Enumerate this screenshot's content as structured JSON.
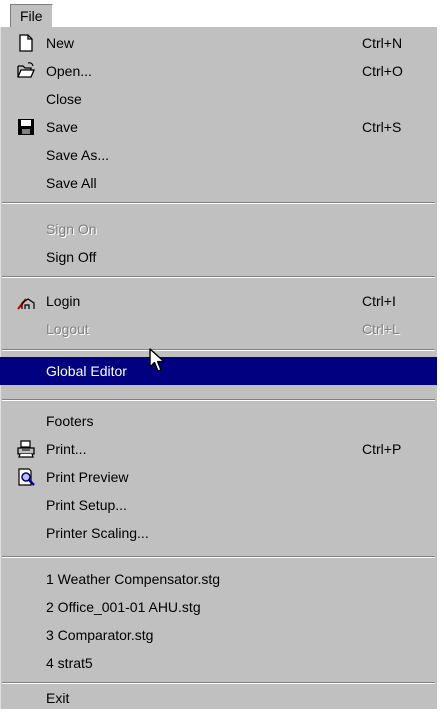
{
  "menubar": {
    "file_label": "File"
  },
  "items": {
    "new": {
      "label": "New",
      "shortcut": "Ctrl+N",
      "icon": "new-document-icon"
    },
    "open": {
      "label": "Open...",
      "shortcut": "Ctrl+O",
      "icon": "open-folder-icon"
    },
    "close": {
      "label": "Close"
    },
    "save": {
      "label": "Save",
      "shortcut": "Ctrl+S",
      "icon": "floppy-disk-icon"
    },
    "save_as": {
      "label": "Save As..."
    },
    "save_all": {
      "label": "Save All"
    },
    "sign_on": {
      "label": "Sign On",
      "disabled": true
    },
    "sign_off": {
      "label": "Sign Off"
    },
    "login": {
      "label": "Login",
      "shortcut": "Ctrl+I",
      "icon": "login-icon"
    },
    "logout": {
      "label": "Logout",
      "shortcut": "Ctrl+L",
      "disabled": true
    },
    "global_editor": {
      "label": "Global Editor",
      "selected": true
    },
    "footers": {
      "label": "Footers"
    },
    "print": {
      "label": "Print...",
      "shortcut": "Ctrl+P",
      "icon": "printer-icon"
    },
    "print_preview": {
      "label": "Print Preview",
      "icon": "print-preview-icon"
    },
    "print_setup": {
      "label": "Print Setup..."
    },
    "printer_scaling": {
      "label": "Printer Scaling..."
    },
    "recent_1": {
      "label": "1 Weather Compensator.stg"
    },
    "recent_2": {
      "label": "2 Office_001-01 AHU.stg"
    },
    "recent_3": {
      "label": "3 Comparator.stg"
    },
    "recent_4": {
      "label": "4 strat5"
    },
    "exit": {
      "label": "Exit"
    }
  },
  "colors": {
    "menu_face": "#c0c0c0",
    "highlight": "#000080",
    "disabled_text": "#808080"
  }
}
